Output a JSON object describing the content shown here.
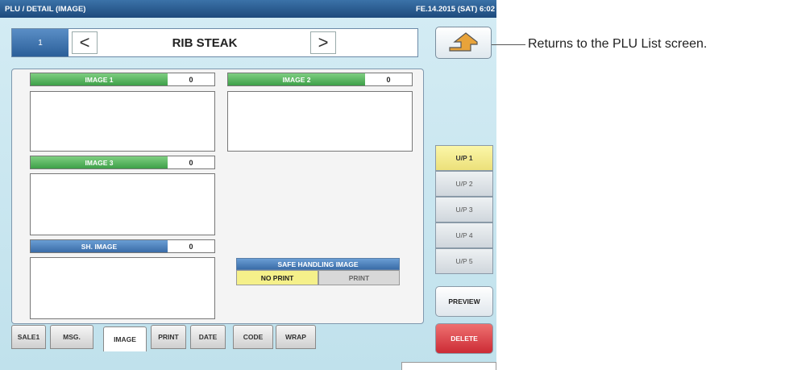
{
  "titlebar": {
    "title": "PLU / DETAIL (IMAGE)",
    "datetime": "FE.14.2015 (SAT)  6:02"
  },
  "navbar": {
    "plu_number": "1",
    "prev_label": "<",
    "name": "RIB STEAK",
    "next_label": ">"
  },
  "return_button": {
    "icon": "return-arrow-icon"
  },
  "callout": "Returns to the PLU List screen.",
  "images": [
    {
      "label": "IMAGE 1",
      "value": "0"
    },
    {
      "label": "IMAGE 2",
      "value": "0"
    },
    {
      "label": "IMAGE 3",
      "value": "0"
    },
    {
      "label": "SH. IMAGE",
      "value": "0"
    }
  ],
  "safe_handling": {
    "title": "SAFE HANDLING IMAGE",
    "options": [
      "NO PRINT",
      "PRINT"
    ],
    "selected": "NO PRINT"
  },
  "unit_prices": [
    "U/P 1",
    "U/P 2",
    "U/P 3",
    "U/P 4",
    "U/P 5"
  ],
  "unit_price_selected": "U/P 1",
  "preview_label": "PREVIEW",
  "delete_label": "DELETE",
  "tabs": [
    "SALE1",
    "MSG.",
    "IMAGE",
    "PRINT",
    "DATE",
    "CODE",
    "WRAP"
  ],
  "active_tab": "IMAGE",
  "colors": {
    "title_bar": "#2b5f93",
    "image_header_green": "#4aab52",
    "image_header_blue": "#3f72ac",
    "selected_yellow": "#f5f08a",
    "delete_red": "#d8343d"
  }
}
